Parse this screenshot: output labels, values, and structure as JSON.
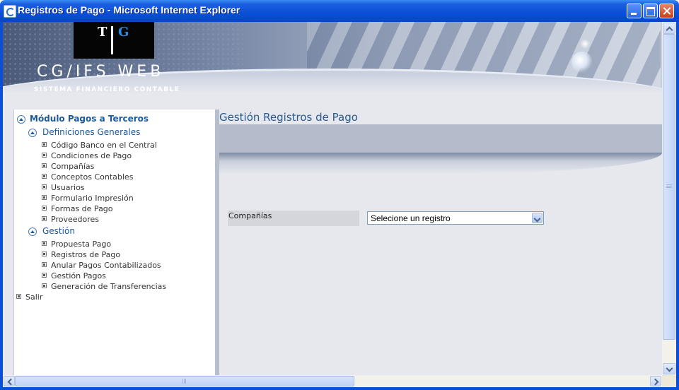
{
  "window": {
    "title": "Registros de Pago - Microsoft Internet Explorer",
    "controls": [
      "minimize",
      "maximize",
      "close"
    ]
  },
  "header": {
    "logo_letters": [
      "T",
      "G"
    ],
    "brand": "CG/IFS WEB",
    "tagline": "SISTEMA FINANCIERO CONTABLE"
  },
  "sidebar": {
    "module_title": "Módulo Pagos a Terceros",
    "sections": [
      {
        "title": "Definiciones Generales",
        "items": [
          "Código Banco en el Central",
          "Condiciones de Pago",
          "Compañías",
          "Conceptos Contables",
          "Usuarios",
          "Formulario Impresión",
          "Formas de Pago",
          "Proveedores"
        ]
      },
      {
        "title": "Gestión",
        "items": [
          "Propuesta Pago",
          "Registros de Pago",
          "Anular Pagos Contabilizados",
          "Gestión Pagos",
          "Generación de Transferencias"
        ]
      }
    ],
    "exit": "Salir"
  },
  "main": {
    "title": "Gestión Registros de Pago",
    "field_label": "Compañías",
    "select_value": "Selecione un registro"
  },
  "colors": {
    "titlebar": "#0a4fd6",
    "link": "#1b5a9a",
    "heading": "#2a5a8e"
  }
}
